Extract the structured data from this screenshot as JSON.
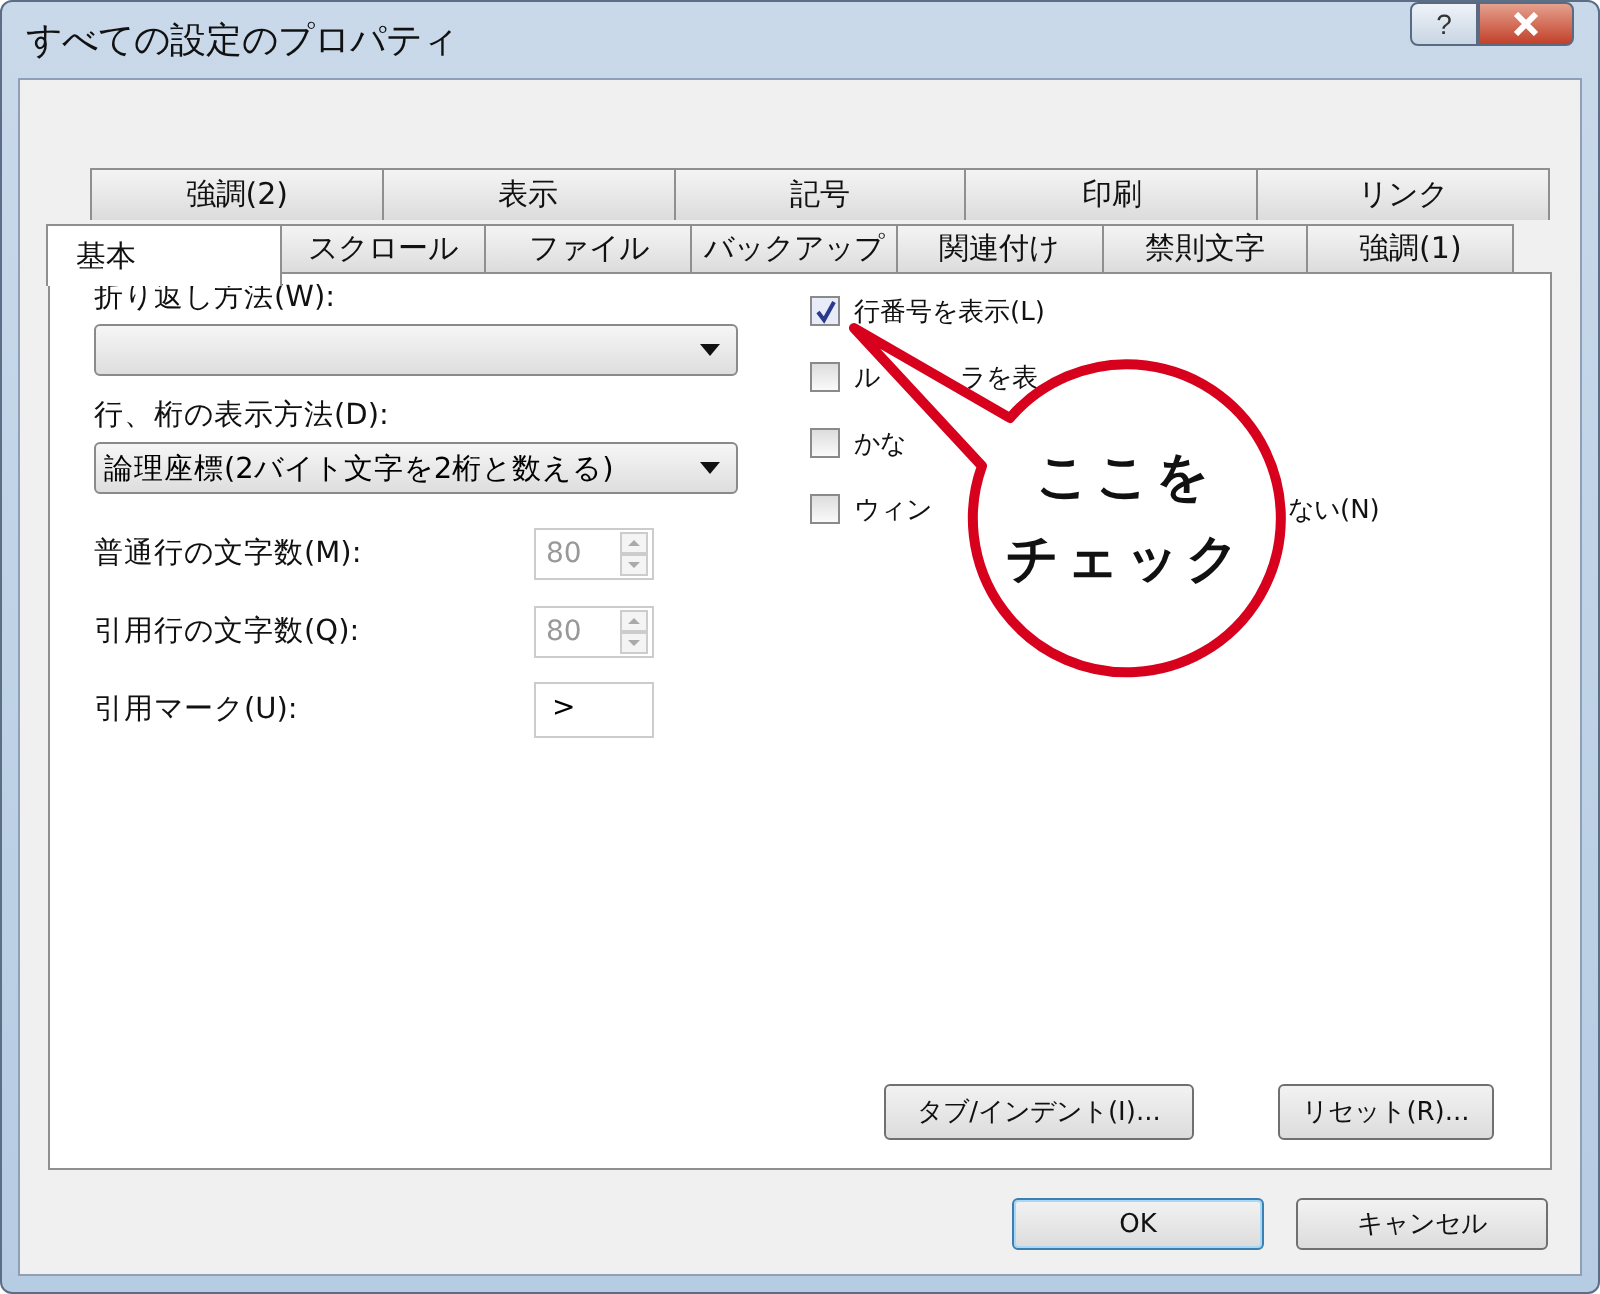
{
  "window": {
    "title": "すべての設定のプロパティ",
    "help_label": "?"
  },
  "tab_rows": [
    [
      {
        "label": "強調(2)",
        "selected": false
      },
      {
        "label": "表示",
        "selected": false
      },
      {
        "label": "記号",
        "selected": false
      },
      {
        "label": "印刷",
        "selected": false
      },
      {
        "label": "リンク",
        "selected": false
      }
    ],
    [
      {
        "label": "基本",
        "selected": true
      },
      {
        "label": "スクロール",
        "selected": false
      },
      {
        "label": "ファイル",
        "selected": false
      },
      {
        "label": "バックアップ",
        "selected": false
      },
      {
        "label": "関連付け",
        "selected": false
      },
      {
        "label": "禁則文字",
        "selected": false
      },
      {
        "label": "強調(1)",
        "selected": false
      }
    ]
  ],
  "fields": [
    {
      "kind": "dropdown",
      "label": "折り返し方法(W):"
    },
    {
      "kind": "dropdown",
      "label": "行、桁の表示方法(D):",
      "value": "論理座標(2バイト文字を2桁と数える)"
    },
    {
      "kind": "spin",
      "label": "普通行の文字数(M):",
      "value": "80",
      "disabled": true
    },
    {
      "kind": "spin",
      "label": "引用行の文字数(Q):",
      "value": "80",
      "disabled": true
    },
    {
      "kind": "text",
      "label": "引用マーク(U):",
      "value": ">"
    }
  ],
  "checkboxes": [
    {
      "label": "行番号を表示(L)",
      "checked": true
    },
    {
      "label": "ル",
      "label_tail": "ラを表",
      "checked": false
    },
    {
      "label": "かな",
      "checked": false
    },
    {
      "label": "ウィン",
      "label_tail": "ない(N)",
      "checked": false
    }
  ],
  "panel_buttons": [
    {
      "label": "タブ/インデント(I)..."
    },
    {
      "label": "リセット(R)..."
    }
  ],
  "dialog_buttons": [
    {
      "label": "OK",
      "default": true
    },
    {
      "label": "キャンセル",
      "default": false
    }
  ],
  "callout": {
    "lines": [
      "ここを",
      "チェック"
    ]
  }
}
